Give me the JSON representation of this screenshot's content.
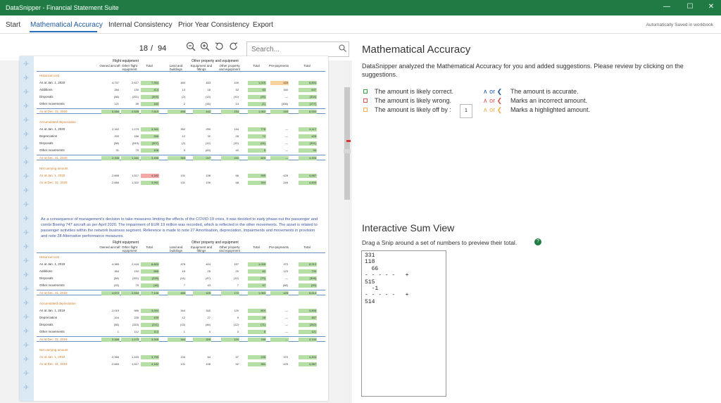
{
  "window": {
    "title": "DataSnipper - Financial Statement Suite",
    "controls": [
      "—",
      "☐",
      "✕"
    ]
  },
  "menu": {
    "tabs": [
      "Start",
      "Mathematical Accuracy",
      "Internal Consistency",
      "Prior Year Consistency",
      "Export"
    ],
    "active_tab": "Mathematical Accuracy",
    "autosave": "Automatically Saved in workbook"
  },
  "viewer": {
    "page": "18",
    "separator": "/",
    "total_pages": "94",
    "search_placeholder": "Search...",
    "icons": [
      "zoom-out-icon",
      "zoom-in-icon",
      "rotate-left-icon",
      "rotate-right-icon"
    ]
  },
  "document": {
    "table1": {
      "group_flight": "Flight equipment",
      "group_other": "Other property and equipment",
      "headers": [
        "Owned aircraft",
        "Other flight equipment",
        "Total",
        "Land and buildings",
        "Equipment and fittings",
        "Other property and equipment",
        "Total",
        "Pre-payments",
        "Total"
      ],
      "rows": [
        {
          "label": "Historical cost",
          "orange": true,
          "cells": []
        },
        {
          "label": "As at Jan. 1, 2020",
          "cells": [
            "4,737",
            "2,617",
            "7,354",
            "483",
            "453",
            "199",
            "1,025",
            "425",
            "8,804"
          ]
        },
        {
          "label": "Additions",
          "cells": [
            "284",
            "130",
            "414",
            "13",
            "18",
            "32",
            "63",
            "160",
            "637"
          ]
        },
        {
          "label": "Disposals",
          "cells": [
            "(58)",
            "(251)",
            "(309)",
            "(2)",
            "(13)",
            "(10)",
            "(25)",
            "—",
            "(334)"
          ]
        },
        {
          "label": "Other movements",
          "cells": [
            "121",
            "39",
            "160",
            "2",
            "(16)",
            "13",
            "(1)",
            "(336)",
            "(177)"
          ]
        },
        {
          "label": "As at Dec. 31, 2020",
          "orange": true,
          "total": true,
          "cells": [
            "5,084",
            "2,535",
            "7,619",
            "496",
            "442",
            "234",
            "1,062",
            "249",
            "8,930"
          ]
        },
        {
          "label": "Accumulated depreciation",
          "orange": true,
          "cells": []
        },
        {
          "label": "As at Jan. 1, 2020",
          "cells": [
            "2,162",
            "1,179",
            "3,341",
            "352",
            "290",
            "134",
            "776",
            "—",
            "4,117"
          ]
        },
        {
          "label": "Depreciation",
          "cells": [
            "200",
            "156",
            "356",
            "12",
            "32",
            "28",
            "72",
            "—",
            "428"
          ]
        },
        {
          "label": "Disposals",
          "cells": [
            "(58)",
            "(249)",
            "(307)",
            "(2)",
            "(12)",
            "(10)",
            "(24)",
            "—",
            "(331)"
          ]
        },
        {
          "label": "Other movements",
          "cells": [
            "31",
            "75",
            "106",
            "3",
            "(63)",
            "40",
            "5",
            "—",
            "34"
          ]
        },
        {
          "label": "As at Dec. 31, 2020",
          "orange": true,
          "total": true,
          "cells": [
            "2,335",
            "1,161",
            "3,496",
            "365",
            "247",
            "192",
            "829",
            "—",
            "4,325"
          ]
        },
        {
          "label": "Net carrying amount",
          "orange": true,
          "cells": []
        },
        {
          "label": "As at Jan. 1, 2020",
          "orange": true,
          "cells": [
            "2,665",
            "1,517",
            "4,182",
            "131",
            "198",
            "66",
            "395",
            "425",
            "4,687"
          ]
        },
        {
          "label": "As at Dec. 31, 2020",
          "orange": true,
          "cells": [
            "2,669",
            "1,322",
            "3,991",
            "131",
            "195",
            "68",
            "394",
            "249",
            "4,605"
          ]
        }
      ]
    },
    "paragraph": "As a consequence of management's decision to take measures limiting the effects of the COVID-19 crisis, it was decided to early phase-out the passenger and combi Boeing 747 aircraft as per April 2020. The impairment of EUR 19 million was recorded, which is reflected in the other movements. The asset is related to passenger activities within the network business segment. Reference is made to note 27 Amortisation, depreciation, impairments and movements in provision and note 28 Alternative performance measures.",
    "table2": {
      "group_flight": "Flight equipment",
      "group_other": "Other property and equipment",
      "headers": [
        "Owned aircraft",
        "Other flight equipment",
        "Total",
        "Land and buildings",
        "Equipment and fittings",
        "Other property and equipment",
        "Total",
        "Pre-payments",
        "Total"
      ],
      "rows": [
        {
          "label": "Historical cost",
          "orange": true,
          "cells": []
        },
        {
          "label": "As at Jan. 1, 2019",
          "cells": [
            "4,385",
            "2,418",
            "6,803",
            "478",
            "404",
            "157",
            "1,039",
            "370",
            "8,212"
          ]
        },
        {
          "label": "Additions",
          "cells": [
            "364",
            "192",
            "556",
            "15",
            "25",
            "20",
            "60",
            "123",
            "739"
          ]
        },
        {
          "label": "Disposals",
          "cells": [
            "(84)",
            "(151)",
            "(235)",
            "(14)",
            "(47)",
            "(12)",
            "(73)",
            "—",
            "(308)"
          ]
        },
        {
          "label": "Other movements",
          "cells": [
            "(93)",
            "75",
            "(18)",
            "7",
            "43",
            "7",
            "57",
            "(68)",
            "(29)"
          ]
        },
        {
          "label": "As at Dec. 31, 2019",
          "orange": true,
          "total": true,
          "cells": [
            "4,572",
            "2,534",
            "7,106",
            "486",
            "425",
            "172",
            "1,083",
            "425",
            "8,614"
          ]
        },
        {
          "label": "Accumulated depreciation",
          "orange": true,
          "cells": []
        },
        {
          "label": "As at Jan. 1, 2019",
          "cells": [
            "2,019",
            "985",
            "3,004",
            "344",
            "340",
            "120",
            "804",
            "—",
            "3,808"
          ]
        },
        {
          "label": "Depreciation",
          "cells": [
            "204",
            "235",
            "439",
            "12",
            "27",
            "9",
            "48",
            "—",
            "487"
          ]
        },
        {
          "label": "Disposals",
          "cells": [
            "(58)",
            "(153)",
            "(211)",
            "(13)",
            "(46)",
            "(12)",
            "(71)",
            "—",
            "(282)"
          ]
        },
        {
          "label": "Other movements",
          "cells": [
            "1",
            "112",
            "113",
            "1",
            "4",
            "3",
            "8",
            "—",
            "121"
          ]
        },
        {
          "label": "As at Dec. 31, 2019",
          "orange": true,
          "total": true,
          "cells": [
            "2,166",
            "1,179",
            "3,345",
            "344",
            "325",
            "120",
            "789",
            "—",
            "4,134"
          ]
        },
        {
          "label": "Net carrying amount",
          "orange": true,
          "cells": []
        },
        {
          "label": "As at Jan. 1, 2019",
          "orange": true,
          "cells": [
            "2,366",
            "1,433",
            "3,799",
            "134",
            "64",
            "37",
            "235",
            "370",
            "4,404"
          ]
        },
        {
          "label": "As at Dec. 31, 2019",
          "orange": true,
          "cells": [
            "2,665",
            "1,517",
            "4,182",
            "131",
            "198",
            "52",
            "381",
            "425",
            "4,987"
          ]
        }
      ]
    }
  },
  "panel": {
    "title": "Mathematical Accuracy",
    "description": "DataSnipper analyzed the Mathematical Accuracy for you and added suggestions. Please review by clicking on the suggestions.",
    "legend": [
      {
        "text": "The amount is likely correct.",
        "color": "#3a9d46"
      },
      {
        "text": "The amount is likely wrong.",
        "color": "#d9534f"
      },
      {
        "text": "The amount is likely off by :",
        "color": "#f0ad4e"
      }
    ],
    "offby_value": "1",
    "carets": [
      {
        "symbol": "∧ or ❮",
        "color": "#1f5aa0",
        "text": "The amount is accurate."
      },
      {
        "symbol": "∧ or ❮",
        "color": "#d9534f",
        "text": "Marks an incorrect amount."
      },
      {
        "symbol": "∧ or ❮",
        "color": "#f0ad4e",
        "text": "Marks a highlighted amount."
      }
    ],
    "or_word": "or",
    "sum_title": "Interactive Sum View",
    "sum_desc": "Drag a Snip around a set of numbers to preview their total.",
    "sum_lines": [
      "331",
      "118",
      "  66",
      "- - - - -   +",
      "515",
      "  -1",
      "- - - - -   +",
      "514"
    ]
  }
}
